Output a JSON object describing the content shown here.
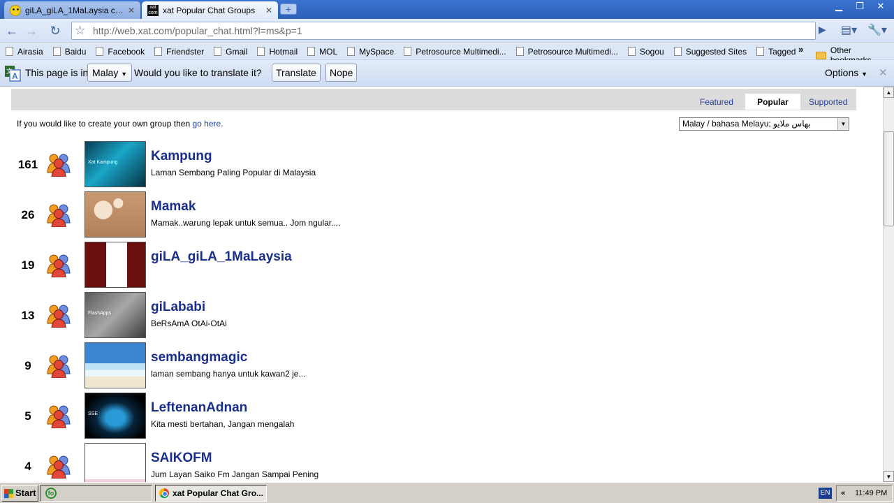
{
  "browser": {
    "tabs": [
      {
        "title": "giLA_giLA_1MaLaysia chat ...",
        "active": false
      },
      {
        "title": "xat Popular Chat Groups",
        "active": true
      }
    ],
    "url": "http://web.xat.com/popular_chat.html?l=ms&p=1",
    "bookmarks": [
      "Airasia",
      "Baidu",
      "Facebook",
      "Friendster",
      "Gmail",
      "Hotmail",
      "MOL",
      "MySpace",
      "Petrosource Multimedi...",
      "Petrosource Multimedi...",
      "Sogou",
      "Suggested Sites",
      "Tagged"
    ],
    "bookmarks_more": "»",
    "other_bookmarks": "Other bookmarks"
  },
  "translate_bar": {
    "text_before": "This page is in",
    "language": "Malay",
    "question": "Would you like to translate it?",
    "translate_label": "Translate",
    "nope_label": "Nope",
    "options_label": "Options"
  },
  "page": {
    "tabs": [
      "Featured",
      "Popular",
      "Supported"
    ],
    "active_tab": "Popular",
    "intro_text": "If you would like to create your own group then",
    "intro_link": "go here.",
    "language_dropdown": "Malay / bahasa Melayu; بهاس ملايو",
    "groups": [
      {
        "count": "161",
        "name": "Kampung",
        "description": "Laman Sembang Paling Popular di Malaysia",
        "thumb": "th-kampung",
        "thumb_text": "Xat Kampung"
      },
      {
        "count": "26",
        "name": "Mamak",
        "description": "Mamak..warung lepak untuk semua.. Jom ngular....",
        "thumb": "th-mamak",
        "thumb_text": ""
      },
      {
        "count": "19",
        "name": "giLA_giLA_1MaLaysia",
        "description": "",
        "thumb": "th-gila",
        "thumb_text": ""
      },
      {
        "count": "13",
        "name": "giLababi",
        "description": "BeRsAmA OtAi-OtAi",
        "thumb": "th-gilababi",
        "thumb_text": "FlashApps"
      },
      {
        "count": "9",
        "name": "sembangmagic",
        "description": "laman sembang hanya untuk kawan2 je...",
        "thumb": "th-sembang",
        "thumb_text": ""
      },
      {
        "count": "5",
        "name": "LeftenanAdnan",
        "description": "Kita mesti bertahan, Jangan mengalah",
        "thumb": "th-leftenan",
        "thumb_text": "SSE"
      },
      {
        "count": "4",
        "name": "SAIKOFM",
        "description": "Jum Layan Saiko Fm Jangan Sampai Pening",
        "thumb": "th-saiko",
        "thumb_text": ""
      }
    ]
  },
  "taskbar": {
    "start_label": "Start",
    "active_task": "xat Popular Chat Gro...",
    "language_indicator": "EN",
    "clock": "11:49 PM"
  }
}
